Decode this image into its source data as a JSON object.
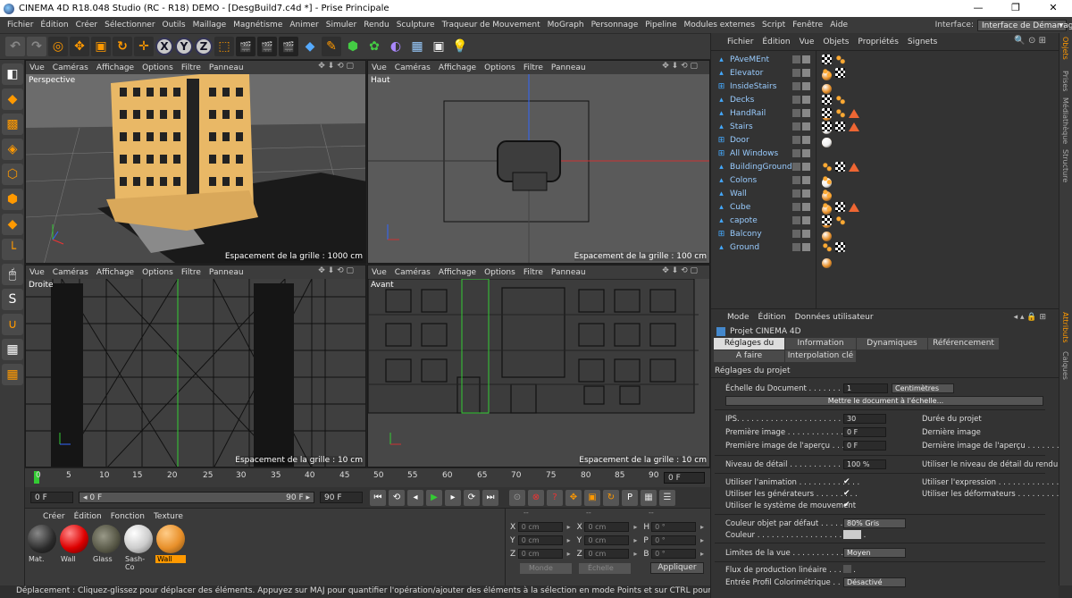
{
  "titlebar": {
    "title": "CINEMA 4D R18.048 Studio (RC - R18) DEMO - [DesgBuild7.c4d *] - Prise Principale",
    "minimize": "—",
    "maximize": "❐",
    "close": "✕"
  },
  "menubar": {
    "items": [
      "Fichier",
      "Édition",
      "Créer",
      "Sélectionner",
      "Outils",
      "Maillage",
      "Magnétisme",
      "Animer",
      "Simuler",
      "Rendu",
      "Sculpture",
      "Traqueur de Mouvement",
      "MoGraph",
      "Personnage",
      "Pipeline",
      "Modules externes",
      "Script",
      "Fenêtre",
      "Aide"
    ],
    "interface_label": "Interface:",
    "interface_value": "Interface de Démarrage"
  },
  "viewports": {
    "menu": [
      "Vue",
      "Caméras",
      "Affichage",
      "Options",
      "Filtre",
      "Panneau"
    ],
    "controls": "✥ ⬇ ⟲ ▢",
    "perspective": {
      "name": "Perspective",
      "grid": "Espacement de la grille : 1000 cm"
    },
    "top": {
      "name": "Haut",
      "grid": "Espacement de la grille : 100 cm"
    },
    "right": {
      "name": "Droite",
      "grid": "Espacement de la grille : 10 cm"
    },
    "front": {
      "name": "Avant",
      "grid": "Espacement de la grille : 10 cm"
    }
  },
  "timeline": {
    "ticks": [
      "0",
      "5",
      "10",
      "15",
      "20",
      "25",
      "30",
      "35",
      "40",
      "45",
      "50",
      "55",
      "60",
      "65",
      "70",
      "75",
      "80",
      "85",
      "90"
    ],
    "frame": "0 F"
  },
  "playbar": {
    "start": "0 F",
    "range_start": "◂ 0 F",
    "range_end": "90 F ▸",
    "end": "90 F"
  },
  "material_manager": {
    "menu": [
      "Créer",
      "Édition",
      "Fonction",
      "Texture"
    ],
    "materials": [
      {
        "name": "Mat.",
        "color": "#2a2a2a"
      },
      {
        "name": "Wall",
        "color": "#d00"
      },
      {
        "name": "Glass",
        "color": "#776"
      },
      {
        "name": "Sash-Co",
        "color": "#ddd"
      },
      {
        "name": "Wall",
        "color": "#e8902a"
      }
    ]
  },
  "coordinates": {
    "headers": [
      "--",
      "--",
      "--"
    ],
    "rows": [
      {
        "a": "X",
        "av": "0 cm",
        "b": "X",
        "bv": "0 cm",
        "c": "H",
        "cv": "0 °"
      },
      {
        "a": "Y",
        "av": "0 cm",
        "b": "Y",
        "bv": "0 cm",
        "c": "P",
        "cv": "0 °"
      },
      {
        "a": "Z",
        "av": "0 cm",
        "b": "Z",
        "bv": "0 cm",
        "c": "B",
        "cv": "0 °"
      }
    ],
    "mode1": "Monde",
    "mode2": "Échelle",
    "apply": "Appliquer"
  },
  "status": "Déplacement : Cliquez-glissez pour déplacer des éléments. Appuyez sur MAJ pour quantifier l'opération/ajouter des éléments à la sélection en mode Points et sur CTRL pour en supprimer",
  "object_manager": {
    "menu": [
      "Fichier",
      "Édition",
      "Vue",
      "Objets",
      "Propriétés",
      "Signets"
    ],
    "objects": [
      {
        "name": "PAveMEnt",
        "icon": "layer-icon",
        "tags": [
          "checker",
          "dots",
          "mat"
        ]
      },
      {
        "name": "Elevator",
        "icon": "layer-icon",
        "tags": [
          "mat",
          "dots",
          "checker"
        ]
      },
      {
        "name": "InsideStairs",
        "icon": "null-icon",
        "tags": []
      },
      {
        "name": "Decks",
        "icon": "layer-icon",
        "tags": [
          "checker",
          "dots",
          "mat"
        ]
      },
      {
        "name": "HandRail",
        "icon": "layer-icon",
        "tags": [
          "checker",
          "dots",
          "mat",
          "mat",
          "tri"
        ]
      },
      {
        "name": "Stairs",
        "icon": "layer-icon",
        "tags": [
          "checker",
          "checker",
          "mat",
          "tri",
          "mat"
        ]
      },
      {
        "name": "Door",
        "icon": "null-icon",
        "tags": []
      },
      {
        "name": "All Windows",
        "icon": "null-icon",
        "tags": []
      },
      {
        "name": "BuildingGround",
        "icon": "layer-icon",
        "tags": [
          "mat",
          "dots",
          "checker",
          "mat",
          "tri"
        ]
      },
      {
        "name": "Colons",
        "icon": "layer-icon",
        "tags": [
          "mat",
          "dots"
        ]
      },
      {
        "name": "Wall",
        "icon": "layer-icon",
        "tags": [
          "mat",
          "dots"
        ]
      },
      {
        "name": "Cube",
        "icon": "layer-icon",
        "tags": [
          "dots",
          "checker",
          "mat",
          "mat",
          "mat",
          "tri"
        ]
      },
      {
        "name": "capote",
        "icon": "layer-icon",
        "tags": [
          "checker",
          "dots",
          "mat"
        ]
      },
      {
        "name": "Balcony",
        "icon": "null-icon",
        "tags": []
      },
      {
        "name": "Ground",
        "icon": "layer-icon",
        "tags": [
          "dots",
          "checker",
          "mat"
        ]
      }
    ]
  },
  "attributes": {
    "menu": [
      "Mode",
      "Édition",
      "Données utilisateur"
    ],
    "title": "Projet CINEMA 4D",
    "tabs": [
      "Réglages du projet",
      "Information",
      "Dynamiques",
      "Référencement",
      "A faire",
      "Interpolation clé"
    ],
    "section": "Réglages du projet",
    "scale_label": "Échelle du Document . . . . . . . . . . .",
    "scale_value": "1",
    "scale_unit": "Centimètres",
    "scale_button": "Mettre le document à l'échelle...",
    "fps_label": "IPS. . . . . . . . . . . . . . . . . . . . . . . . . . . .",
    "fps_value": "30",
    "duration_label": "Durée du projet",
    "first_label": "Première image . . . . . . . . . . . . . . . .",
    "first_value": "0 F",
    "last_label": "Dernière image",
    "first_preview_label": "Première image de l'aperçu . . . . . .",
    "first_preview_value": "0 F",
    "last_preview_label": "Dernière image de l'aperçu . . . . . . . . .",
    "lod_label": "Niveau de détail . . . . . . . . . . . . . . .",
    "lod_value": "100 %",
    "lod_render_label": "Utiliser le niveau de détail du rendu",
    "use_anim": "Utiliser l'animation . . . . . . . . . . . . .",
    "use_expr": "Utiliser l'expression . . . . . . . . . . . . . .",
    "use_gen": "Utiliser les générateurs . . . . . . . . .",
    "use_deform": "Utiliser les déformateurs . . . . . . . . . .",
    "use_motion": "Utiliser le système de mouvement",
    "default_color_label": "Couleur objet par défaut . . . . . . . .",
    "default_color_value": "80% Gris",
    "color_label": "Couleur . . . . . . . . . . . . . . . . . . . . . . .",
    "view_limit_label": "Limites de la vue . . . . . . . . . . . . .",
    "view_limit_value": "Moyen",
    "linear_label": "Flux de production linéaire . . . . . .",
    "profile_label": "Entrée Profil Colorimétrique . . . . . .",
    "profile_value": "Désactivé"
  },
  "right_tabs": [
    "Objets",
    "Prises",
    "Médiathèque",
    "Structure",
    "Attributs",
    "Calques"
  ]
}
